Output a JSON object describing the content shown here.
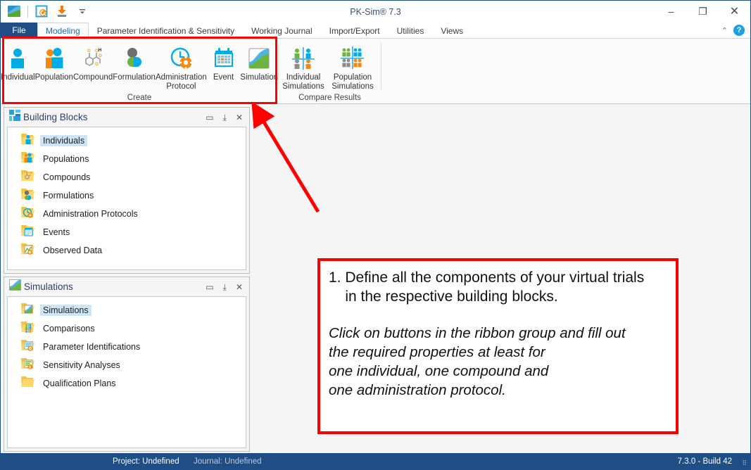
{
  "window": {
    "title": "PK-Sim® 7.3",
    "minimize_label": "–",
    "maximize_label": "❐",
    "close_label": "✕"
  },
  "quick_access": {
    "app_icon": "pksim-logo-icon",
    "items": [
      {
        "name": "open-recent-icon",
        "label": ""
      },
      {
        "name": "save-icon",
        "label": ""
      },
      {
        "name": "customize-qat-chevron-icon",
        "label": "≡"
      }
    ]
  },
  "ribbon": {
    "tabs": [
      {
        "label": "File",
        "active": false,
        "is_file": true
      },
      {
        "label": "Modeling",
        "active": true
      },
      {
        "label": "Parameter Identification & Sensitivity",
        "active": false
      },
      {
        "label": "Working Journal",
        "active": false
      },
      {
        "label": "Import/Export",
        "active": false
      },
      {
        "label": "Utilities",
        "active": false
      },
      {
        "label": "Views",
        "active": false
      }
    ],
    "collapse_label": "⌃",
    "help_label": "?",
    "groups": [
      {
        "title": "Create",
        "buttons": [
          {
            "label": "Individual",
            "icon": "individual-icon"
          },
          {
            "label": "Population",
            "icon": "population-icon"
          },
          {
            "label": "Compound",
            "icon": "compound-icon"
          },
          {
            "label": "Formulation",
            "icon": "formulation-icon"
          },
          {
            "label": "Administration\nProtocol",
            "icon": "administration-protocol-icon"
          },
          {
            "label": "Event",
            "icon": "event-icon"
          },
          {
            "label": "Simulation",
            "icon": "simulation-icon"
          }
        ]
      },
      {
        "title": "Compare Results",
        "buttons": [
          {
            "label": "Individual\nSimulations",
            "icon": "individual-simulations-icon"
          },
          {
            "label": "Population\nSimulations",
            "icon": "population-simulations-icon"
          }
        ]
      }
    ]
  },
  "panels": {
    "building_blocks": {
      "title": "Building Blocks",
      "icon": "building-blocks-icon",
      "header_buttons": [
        {
          "name": "restore-icon",
          "label": "▭"
        },
        {
          "name": "pin-icon",
          "label": "⤓"
        },
        {
          "name": "close-icon",
          "label": "✕"
        }
      ],
      "items": [
        {
          "label": "Individuals",
          "icon": "folder-individuals-icon",
          "selected": true
        },
        {
          "label": "Populations",
          "icon": "folder-populations-icon",
          "selected": false
        },
        {
          "label": "Compounds",
          "icon": "folder-compounds-icon",
          "selected": false
        },
        {
          "label": "Formulations",
          "icon": "folder-formulations-icon",
          "selected": false
        },
        {
          "label": "Administration Protocols",
          "icon": "folder-administration-protocols-icon",
          "selected": false
        },
        {
          "label": "Events",
          "icon": "folder-events-icon",
          "selected": false
        },
        {
          "label": "Observed Data",
          "icon": "folder-observed-data-icon",
          "selected": false
        }
      ]
    },
    "simulations": {
      "title": "Simulations",
      "icon": "simulations-panel-icon",
      "header_buttons": [
        {
          "name": "restore-icon",
          "label": "▭"
        },
        {
          "name": "pin-icon",
          "label": "⤓"
        },
        {
          "name": "close-icon",
          "label": "✕"
        }
      ],
      "items": [
        {
          "label": "Simulations",
          "icon": "folder-simulations-icon",
          "selected": true
        },
        {
          "label": "Comparisons",
          "icon": "folder-comparisons-icon",
          "selected": false
        },
        {
          "label": "Parameter Identifications",
          "icon": "folder-parameter-identifications-icon",
          "selected": false
        },
        {
          "label": "Sensitivity Analyses",
          "icon": "folder-sensitivity-analyses-icon",
          "selected": false
        },
        {
          "label": "Qualification Plans",
          "icon": "folder-qualification-plans-icon",
          "selected": false
        }
      ]
    }
  },
  "annotation": {
    "color": "#ff0000",
    "paragraph_1": "1. Define all the components of your virtual trials\n    in the respective building blocks.",
    "paragraph_2": "Click on buttons in the ribbon group and fill out\nthe required properties at least for\none individual, one compound and\none administration protocol."
  },
  "status_bar": {
    "project": "Project: Undefined",
    "journal": "Journal: Undefined",
    "version": "7.3.0 - Build 42"
  }
}
